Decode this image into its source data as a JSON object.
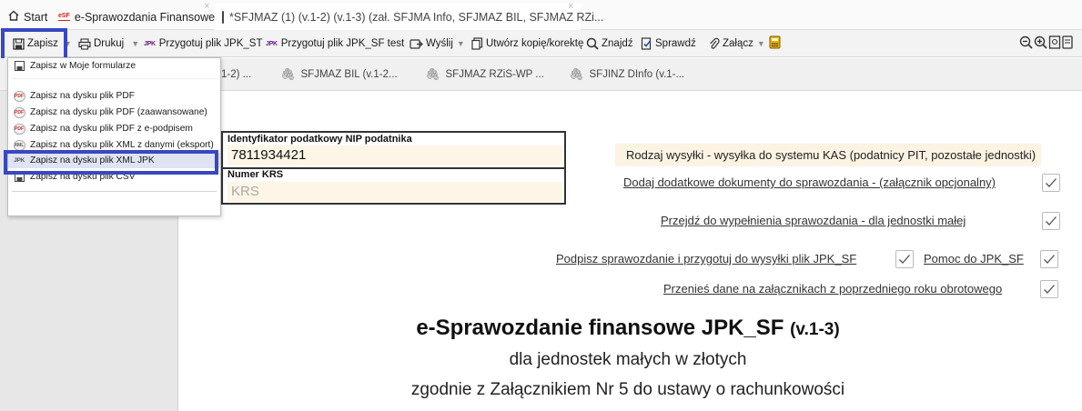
{
  "tabs": [
    {
      "label": "Start",
      "icon": "home-icon"
    },
    {
      "label": "e-Sprawozdania Finansowe",
      "badge": "eSF"
    },
    {
      "label": "*SFJMAZ (1) (v.1-2) (v.1-3) (zał. SFJMA Info, SFJMAZ BIL, SFJMAZ RZi..."
    }
  ],
  "toolbar": {
    "save": "Zapisz",
    "print": "Drukuj",
    "prepare_jpk": "Przygotuj plik JPK_ST",
    "prepare_jpk_badge": "JPK",
    "prepare_jpk_test": "Przygotuj plik JPK_SF test",
    "send": "Wyślij",
    "copy": "Utwórz kopię/korektę",
    "find": "Znajdź",
    "check": "Sprawdź",
    "attach": "Załącz"
  },
  "subtabs": [
    {
      "label": "1-2) ..."
    },
    {
      "label": "SFJMAZ BIL (v.1-2..."
    },
    {
      "label": "SFJMAZ RZiS-WP ..."
    },
    {
      "label": "SFJINZ DInfo (v.1-..."
    }
  ],
  "menu": {
    "items": [
      {
        "label": "Zapisz w Moje formularze",
        "icon": "floppy-icon"
      },
      {
        "label": "Zapisz na dysku plik PDF",
        "icon": "pdf-icon",
        "badge": "PDF"
      },
      {
        "label": "Zapisz na dysku plik PDF (zaawansowane)",
        "icon": "pdf-icon",
        "badge": "PDF"
      },
      {
        "label": "Zapisz na dysku plik PDF z e-podpisem",
        "icon": "pdf-icon",
        "badge": "PDF"
      },
      {
        "label": "Zapisz na dysku plik XML z danymi (eksport)",
        "icon": "xml-icon",
        "badge": "XML"
      },
      {
        "label": "Zapisz na dysku plik XML JPK",
        "icon": "jpk-icon",
        "badge": "JPK",
        "selected": true
      },
      {
        "label": "Zapisz na dysku plik CSV",
        "icon": "floppy-icon"
      }
    ]
  },
  "form": {
    "nip_label": "Identyfikator podatkowy NIP podatnika",
    "nip_value": "7811934421",
    "krs_label": "Numer KRS",
    "krs_placeholder": "KRS"
  },
  "actions": {
    "send_type": "Rodzaj wysyłki - wysyłka do systemu KAS (podatnicy PIT, pozostałe jednostki)",
    "add_docs": "Dodaj dodatkowe dokumenty do sprawozdania - (załącznik opcjonalny)",
    "fill_small": "Przejdź do wypełnienia sprawozdania - dla jednostki małej",
    "sign_prepare": "Podpisz sprawozdanie i przygotuj do wysyłki plik JPK_SF",
    "help": "Pomoc do JPK_SF",
    "transfer": "Przenieś dane na załącznikach z poprzedniego roku obrotowego"
  },
  "heading": {
    "title": "e-Sprawozdanie finansowe JPK_SF",
    "version": "(v.1-3)",
    "line1": "dla jednostek małych w złotych",
    "line2": "zgodnie z Załącznikiem Nr 5 do ustawy o rachunkowości"
  },
  "colors": {
    "highlight": "#3848c0",
    "field_bg": "#fdf6e6",
    "accent_badge": "#d02020",
    "jpk_badge": "#6a1a8a"
  }
}
